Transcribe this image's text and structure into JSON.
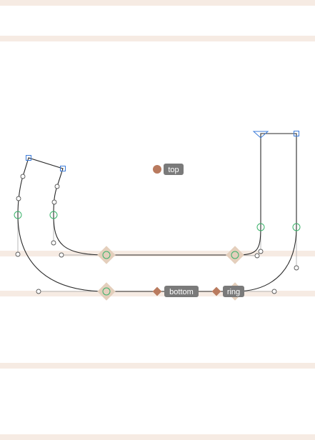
{
  "anchors": {
    "top": "top",
    "bottom": "bottom",
    "ring": "ring"
  },
  "colors": {
    "guideline": "#f6ebe3",
    "path": "#2a2a2a",
    "oncurve_smooth": "#3bb26a",
    "corner_node": "#3b7bd9",
    "anchor": "#b97a5e",
    "anchor_label_bg": "#7a7a7a"
  }
}
